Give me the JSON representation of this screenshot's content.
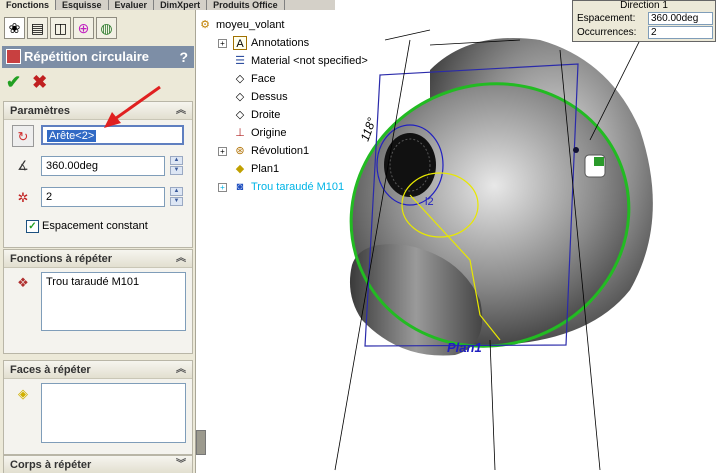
{
  "tabs": [
    "Fonctions",
    "Esquisse",
    "Evaluer",
    "DimXpert",
    "Produits Office"
  ],
  "panel": {
    "title": "Répétition circulaire",
    "help": "?",
    "params_header": "Paramètres",
    "edge_value": "Arête<2>",
    "angle_value": "360.00deg",
    "count_value": "2",
    "equal_spacing_label": "Espacement constant",
    "features_header": "Fonctions à répéter",
    "features_items": [
      "Trou taraudé M101"
    ],
    "faces_header": "Faces à répéter",
    "bodies_header": "Corps à répéter"
  },
  "tree": {
    "root": "moyeu_volant",
    "items": [
      "Annotations",
      "Material <not specified>",
      "Face",
      "Dessus",
      "Droite",
      "Origine",
      "Révolution1",
      "Plan1",
      "Trou taraudé M101"
    ]
  },
  "direction_box": {
    "title": "Direction 1",
    "spacing_label": "Espacement:",
    "spacing_value": "360.00deg",
    "occurrences_label": "Occurrences:",
    "occurrences_value": "2"
  },
  "viewport": {
    "dim_angle": "118°",
    "dim_l": "l2",
    "plane_label": "Plan1"
  },
  "colors": {
    "accent_arrow": "#e02020",
    "selection": "#316ac5",
    "highlight_text": "#00b4e6",
    "green_edge": "#22bb22"
  }
}
